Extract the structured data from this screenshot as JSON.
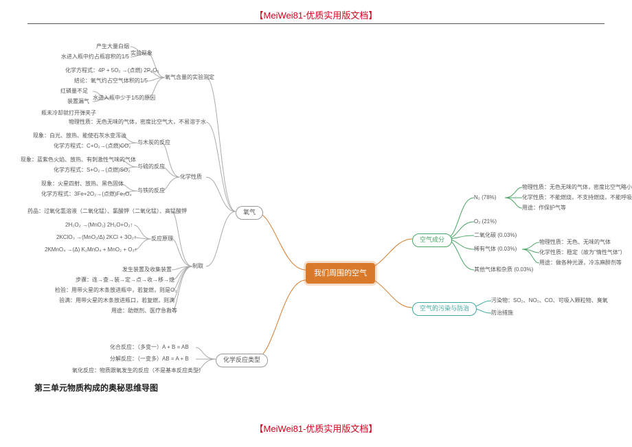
{
  "header": "【MeiWei81-优质实用版文档】",
  "footer": "【MeiWei81-优质实用版文档】",
  "caption": "第三单元物质构成的奥秘思维导图",
  "center": "我们周围的空气",
  "right": {
    "components": {
      "label": "空气成分",
      "items": {
        "n2": {
          "label": "N₂ (78%)",
          "sub": [
            "物理性质：无色无味的气体，密度比空气略小，难溶于水",
            "化学性质：不能燃烧，不支持燃烧，不能呼吸",
            "用途：作保护气等"
          ]
        },
        "o2": {
          "label": "O₂ (21%)"
        },
        "co2": {
          "label": "二氧化碳 (0.03%)"
        },
        "noble": {
          "label": "稀有气体 (0.03%)",
          "sub": [
            "物理性质：无色、无味的气体",
            "化学性质：稳定（故为\"惰性气体\"）",
            "用途：做各种光源，冷冻麻醉剂等"
          ]
        },
        "other": {
          "label": "其他气体和杂质 (0.03%)"
        }
      }
    },
    "pollution": {
      "label": "空气的污染与防治",
      "items": [
        "污染物：SO₂、NO₂、CO、可吸入颗粒物、臭氧",
        "防治措施"
      ]
    }
  },
  "left": {
    "oxygen": {
      "label": "氧气",
      "measure": {
        "label": "氧气含量的实验测定",
        "phenomena": {
          "label": "实验现象",
          "sub": [
            "产生大量白烟",
            "水进入瓶中约占瓶容积的1/5"
          ]
        },
        "equation": "化学方程式：4P + 5O₂ →(点燃) 2P₂O₅",
        "conclusion": "结论：氧气约占空气体积的1/5",
        "less": {
          "label": "水进入瓶中少于1/5的原因",
          "sub": [
            "红磷量不足",
            "装置漏气"
          ]
        },
        "note": "瓶未冷却就打开弹夹子"
      },
      "physical": "物理性质：无色无味的气体，密度比空气大，不易溶于水",
      "chemical": {
        "label": "化学性质",
        "wood": {
          "label": "与木炭的反应",
          "sub": [
            "现象：白光、放热、能使石灰水变浑浊",
            "化学方程式：C+O₂→(点燃)CO₂"
          ]
        },
        "sulfur": {
          "label": "与硫的反应",
          "sub": [
            "现象：蓝紫色火焰、放热、有刺激性气味的气体",
            "化学方程式：S+O₂→(点燃)SO₂"
          ]
        },
        "iron": {
          "label": "与铁的反应",
          "sub": [
            "现象：火星四射、放热、黑色固体",
            "化学方程式：3Fe+2O₂→(点燃)Fe₃O₄"
          ]
        }
      },
      "prepare": {
        "label": "制取",
        "drug": "药品：过氧化氢溶液（二氧化锰）、氯酸钾（二氧化锰）、高锰酸钾",
        "principle": {
          "label": "反应原理",
          "eq": [
            "2H₂O₂ →(MnO₂) 2H₂O+O₂↑",
            "2KClO₃ →(MnO₂/Δ) 2KCl + 3O₂↑",
            "2KMnO₄ →(Δ) K₂MnO₄ + MnO₂ + O₂↑"
          ]
        },
        "device": "发生装置及收集装置",
        "steps": "步骤：连→查→装→定→点→收→移→熄",
        "check": "检验：用带火星的木条放进瓶中，若复燃，则是O₂",
        "full": "验满：用带火星的木条放进瓶口，若复燃，则满",
        "use": "用途：助燃剂、医疗急救等"
      }
    },
    "reactionType": {
      "label": "化学反应类型",
      "items": [
        "化合反应：（多变一）A + B = AB",
        "分解反应：（一变多）AB = A + B",
        "氧化反应：物质跟氧发生的反应（不是基本反应类型）"
      ]
    }
  },
  "chart_data": {
    "type": "mindmap",
    "root": "我们周围的空气",
    "branches": [
      {
        "side": "right",
        "label": "空气成分",
        "children": [
          {
            "label": "N₂ (78%)",
            "children": [
              "物理性质：无色无味的气体，密度比空气略小，难溶于水",
              "化学性质：不能燃烧，不支持燃烧，不能呼吸",
              "用途：作保护气等"
            ]
          },
          {
            "label": "O₂ (21%)"
          },
          {
            "label": "二氧化碳 (0.03%)"
          },
          {
            "label": "稀有气体 (0.03%)",
            "children": [
              "物理性质：无色、无味的气体",
              "化学性质：稳定（故为惰性气体）",
              "用途：做各种光源，冷冻麻醉剂等"
            ]
          },
          {
            "label": "其他气体和杂质 (0.03%)"
          }
        ]
      },
      {
        "side": "right",
        "label": "空气的污染与防治",
        "children": [
          "污染物：SO₂、NO₂、CO、可吸入颗粒物、臭氧",
          "防治措施"
        ]
      },
      {
        "side": "left",
        "label": "氧气",
        "children": [
          {
            "label": "氧气含量的实验测定",
            "children": [
              "实验现象：产生大量白烟；水进入瓶中约占瓶容积的1/5",
              "化学方程式：4P+5O₂→2P₂O₅",
              "结论：氧气约占空气体积的1/5",
              "水进入瓶中少于1/5的原因：红磷量不足；装置漏气",
              "瓶未冷却就打开弹夹子"
            ]
          },
          {
            "label": "物理性质：无色无味的气体，密度比空气大，不易溶于水"
          },
          {
            "label": "化学性质",
            "children": [
              "与木炭的反应",
              "与硫的反应",
              "与铁的反应"
            ]
          },
          {
            "label": "制取",
            "children": [
              "药品",
              "反应原理",
              "发生装置及收集装置",
              "步骤",
              "检验",
              "验满",
              "用途"
            ]
          }
        ]
      },
      {
        "side": "left",
        "label": "化学反应类型",
        "children": [
          "化合反应：A+B=AB",
          "分解反应：AB=A+B",
          "氧化反应：物质跟氧发生的反应"
        ]
      }
    ]
  }
}
